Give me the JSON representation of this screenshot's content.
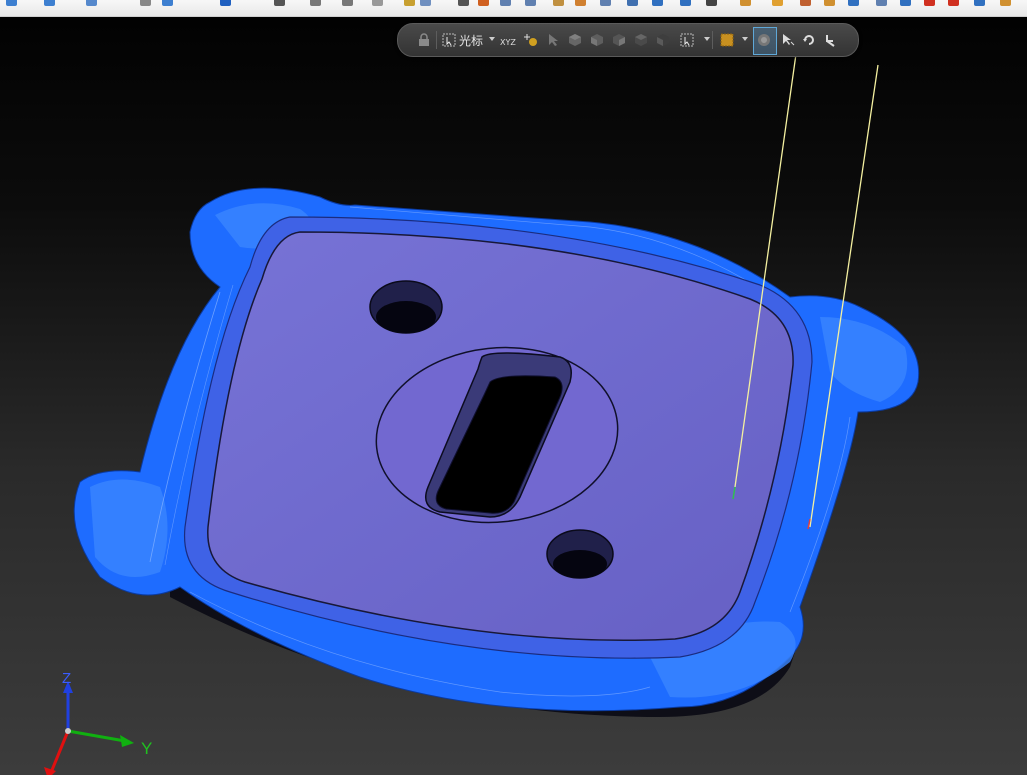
{
  "floating_toolbar": {
    "cursor_label": "光标",
    "xyz_label": "XYZ",
    "tools": [
      "lock-icon",
      "cursor-mode-icon",
      "coordinate-icon",
      "point-snap-icon",
      "select-arrow-icon",
      "view-iso-icon",
      "view-front-icon",
      "view-top-icon",
      "view-side-icon",
      "view-shaded-icon",
      "box-select-icon",
      "marquee-icon",
      "grid-icon",
      "orbit-icon",
      "rotate-icon",
      "undo-view-icon"
    ]
  },
  "triad": {
    "x_label": "",
    "y_label": "Y",
    "z_label": "Z"
  },
  "colors": {
    "model_blue": "#1e6cff",
    "face_purple": "#6f68cf",
    "triad_x": "#e01010",
    "triad_y": "#10b010",
    "triad_z": "#2040e0",
    "toolpath_line": "#f4f0a0"
  }
}
